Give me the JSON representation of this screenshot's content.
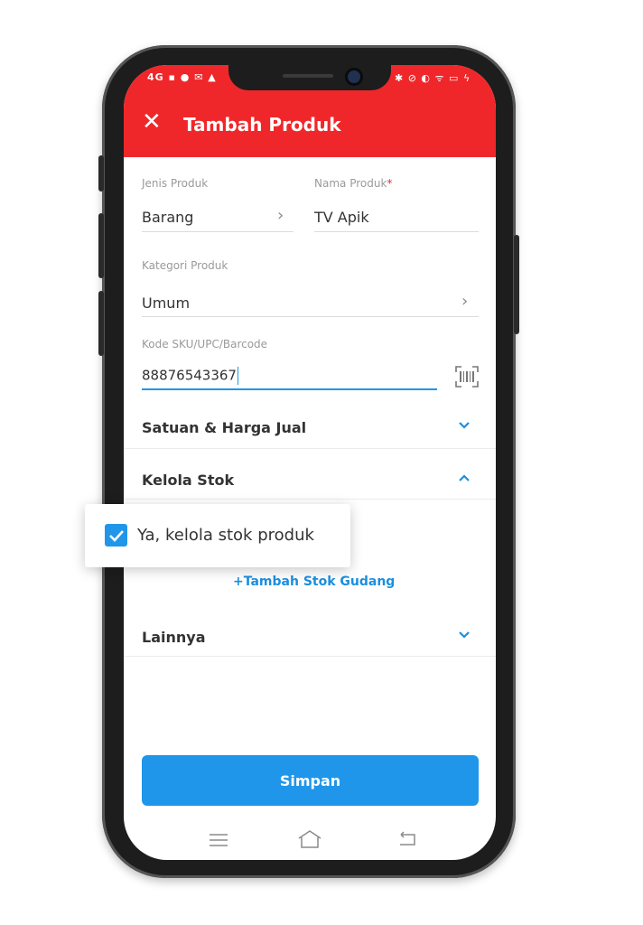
{
  "status_bar": {
    "left_icons": "4G ▪ ● ✉ ▲",
    "right_icons": "✱ ⊘ ◐ ᯤ ▭ ϟ"
  },
  "app_bar": {
    "title": "Tambah Produk",
    "close_icon": "close-icon"
  },
  "form": {
    "jenis_produk": {
      "label": "Jenis Produk",
      "value": "Barang"
    },
    "nama_produk": {
      "label": "Nama Produk",
      "required_mark": "*",
      "value": "TV Apik"
    },
    "kategori_produk": {
      "label": "Kategori Produk",
      "value": "Umum"
    },
    "kode_sku": {
      "label": "Kode SKU/UPC/Barcode",
      "value": "88876543367",
      "scan_icon": "barcode-scan-icon"
    }
  },
  "sections": {
    "satuan_harga": {
      "title": "Satuan & Harga Jual",
      "expanded": false
    },
    "kelola_stok": {
      "title": "Kelola Stok",
      "expanded": true
    },
    "lainnya": {
      "title": "Lainnya",
      "expanded": false
    }
  },
  "kelola_stok_checkbox": {
    "label": "Ya, kelola stok produk",
    "checked": true
  },
  "tambah_stok_link": "+Tambah Stok Gudang",
  "save_button": "Simpan",
  "colors": {
    "app_bar": "#f0272a",
    "accent": "#1f96ea",
    "link": "#1a8fe0"
  },
  "nav_bar": {
    "icons": [
      "menu-icon",
      "home-icon",
      "back-icon"
    ]
  }
}
